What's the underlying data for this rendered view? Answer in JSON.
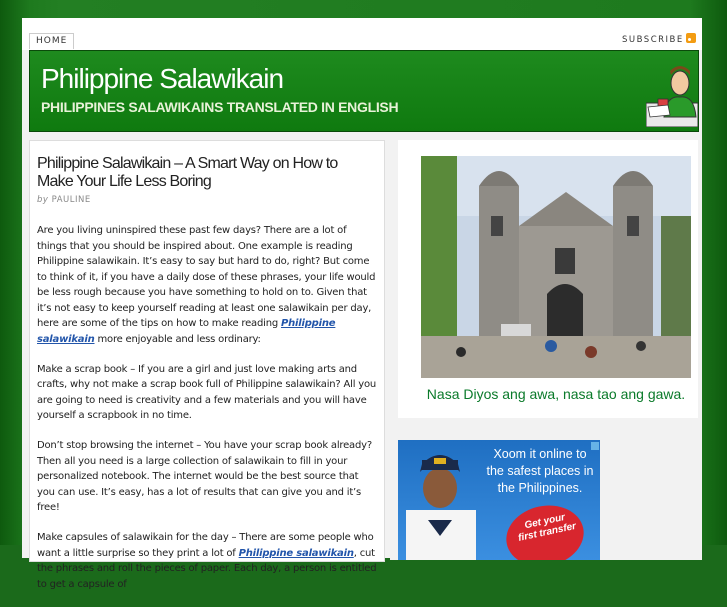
{
  "nav": {
    "home": "HOME",
    "subscribe": "SUBSCRIBE"
  },
  "header": {
    "title": "Philippine Salawikain",
    "tagline": "PHILIPPINES SALAWIKAINS TRANSLATED IN ENGLISH"
  },
  "post": {
    "title": "Philippine Salawikain – A Smart Way on How to Make Your Life Less Boring",
    "by": "by",
    "author": "PAULINE",
    "p1_pre": "Are you living uninspired these past few days? There are a lot of things that you should be inspired about. One example is reading Philippine salawikain. It’s easy to say but hard to do, right? But come to think of it, if you have a daily dose of these phrases, your life would be less rough because you have something to hold on to. Given that it’s not easy to keep yourself reading at least one salawikain per day, here are some of the tips on how to make reading ",
    "p1_link": "Philippine salawikain",
    "p1_post": " more enjoyable and less ordinary:",
    "p2": "Make a scrap book – If you are a girl and just love making arts and crafts, why not make a scrap book full of Philippine salawikain? All you are going to need is creativity and a few materials and you will have yourself a scrapbook in no time.",
    "p3": "Don’t stop browsing the internet – You have your scrap book already? Then all you need is a large collection of salawikain to fill in your personalized notebook. The internet would be the best source that you can use. It’s easy, has a lot of results that can give you and it’s free!",
    "p4_pre": "Make capsules of salawikain for the day – There are some people who want a little surprise so they print a lot of ",
    "p4_link": "Philippine salawikain",
    "p4_post": ", cut the phrases and roll the pieces of paper. Each day, a person is entitled to get a capsule of"
  },
  "sidebar": {
    "photo_caption": "Nasa Diyos ang awa, nasa tao ang gawa.",
    "ad_text": "Xoom it online to the safest places in the Philippines.",
    "ad_badge": "Get your first transfer"
  },
  "colors": {
    "brand_green": "#1e8a1e",
    "link": "#2255aa",
    "caption_green": "#0a7a2a"
  }
}
